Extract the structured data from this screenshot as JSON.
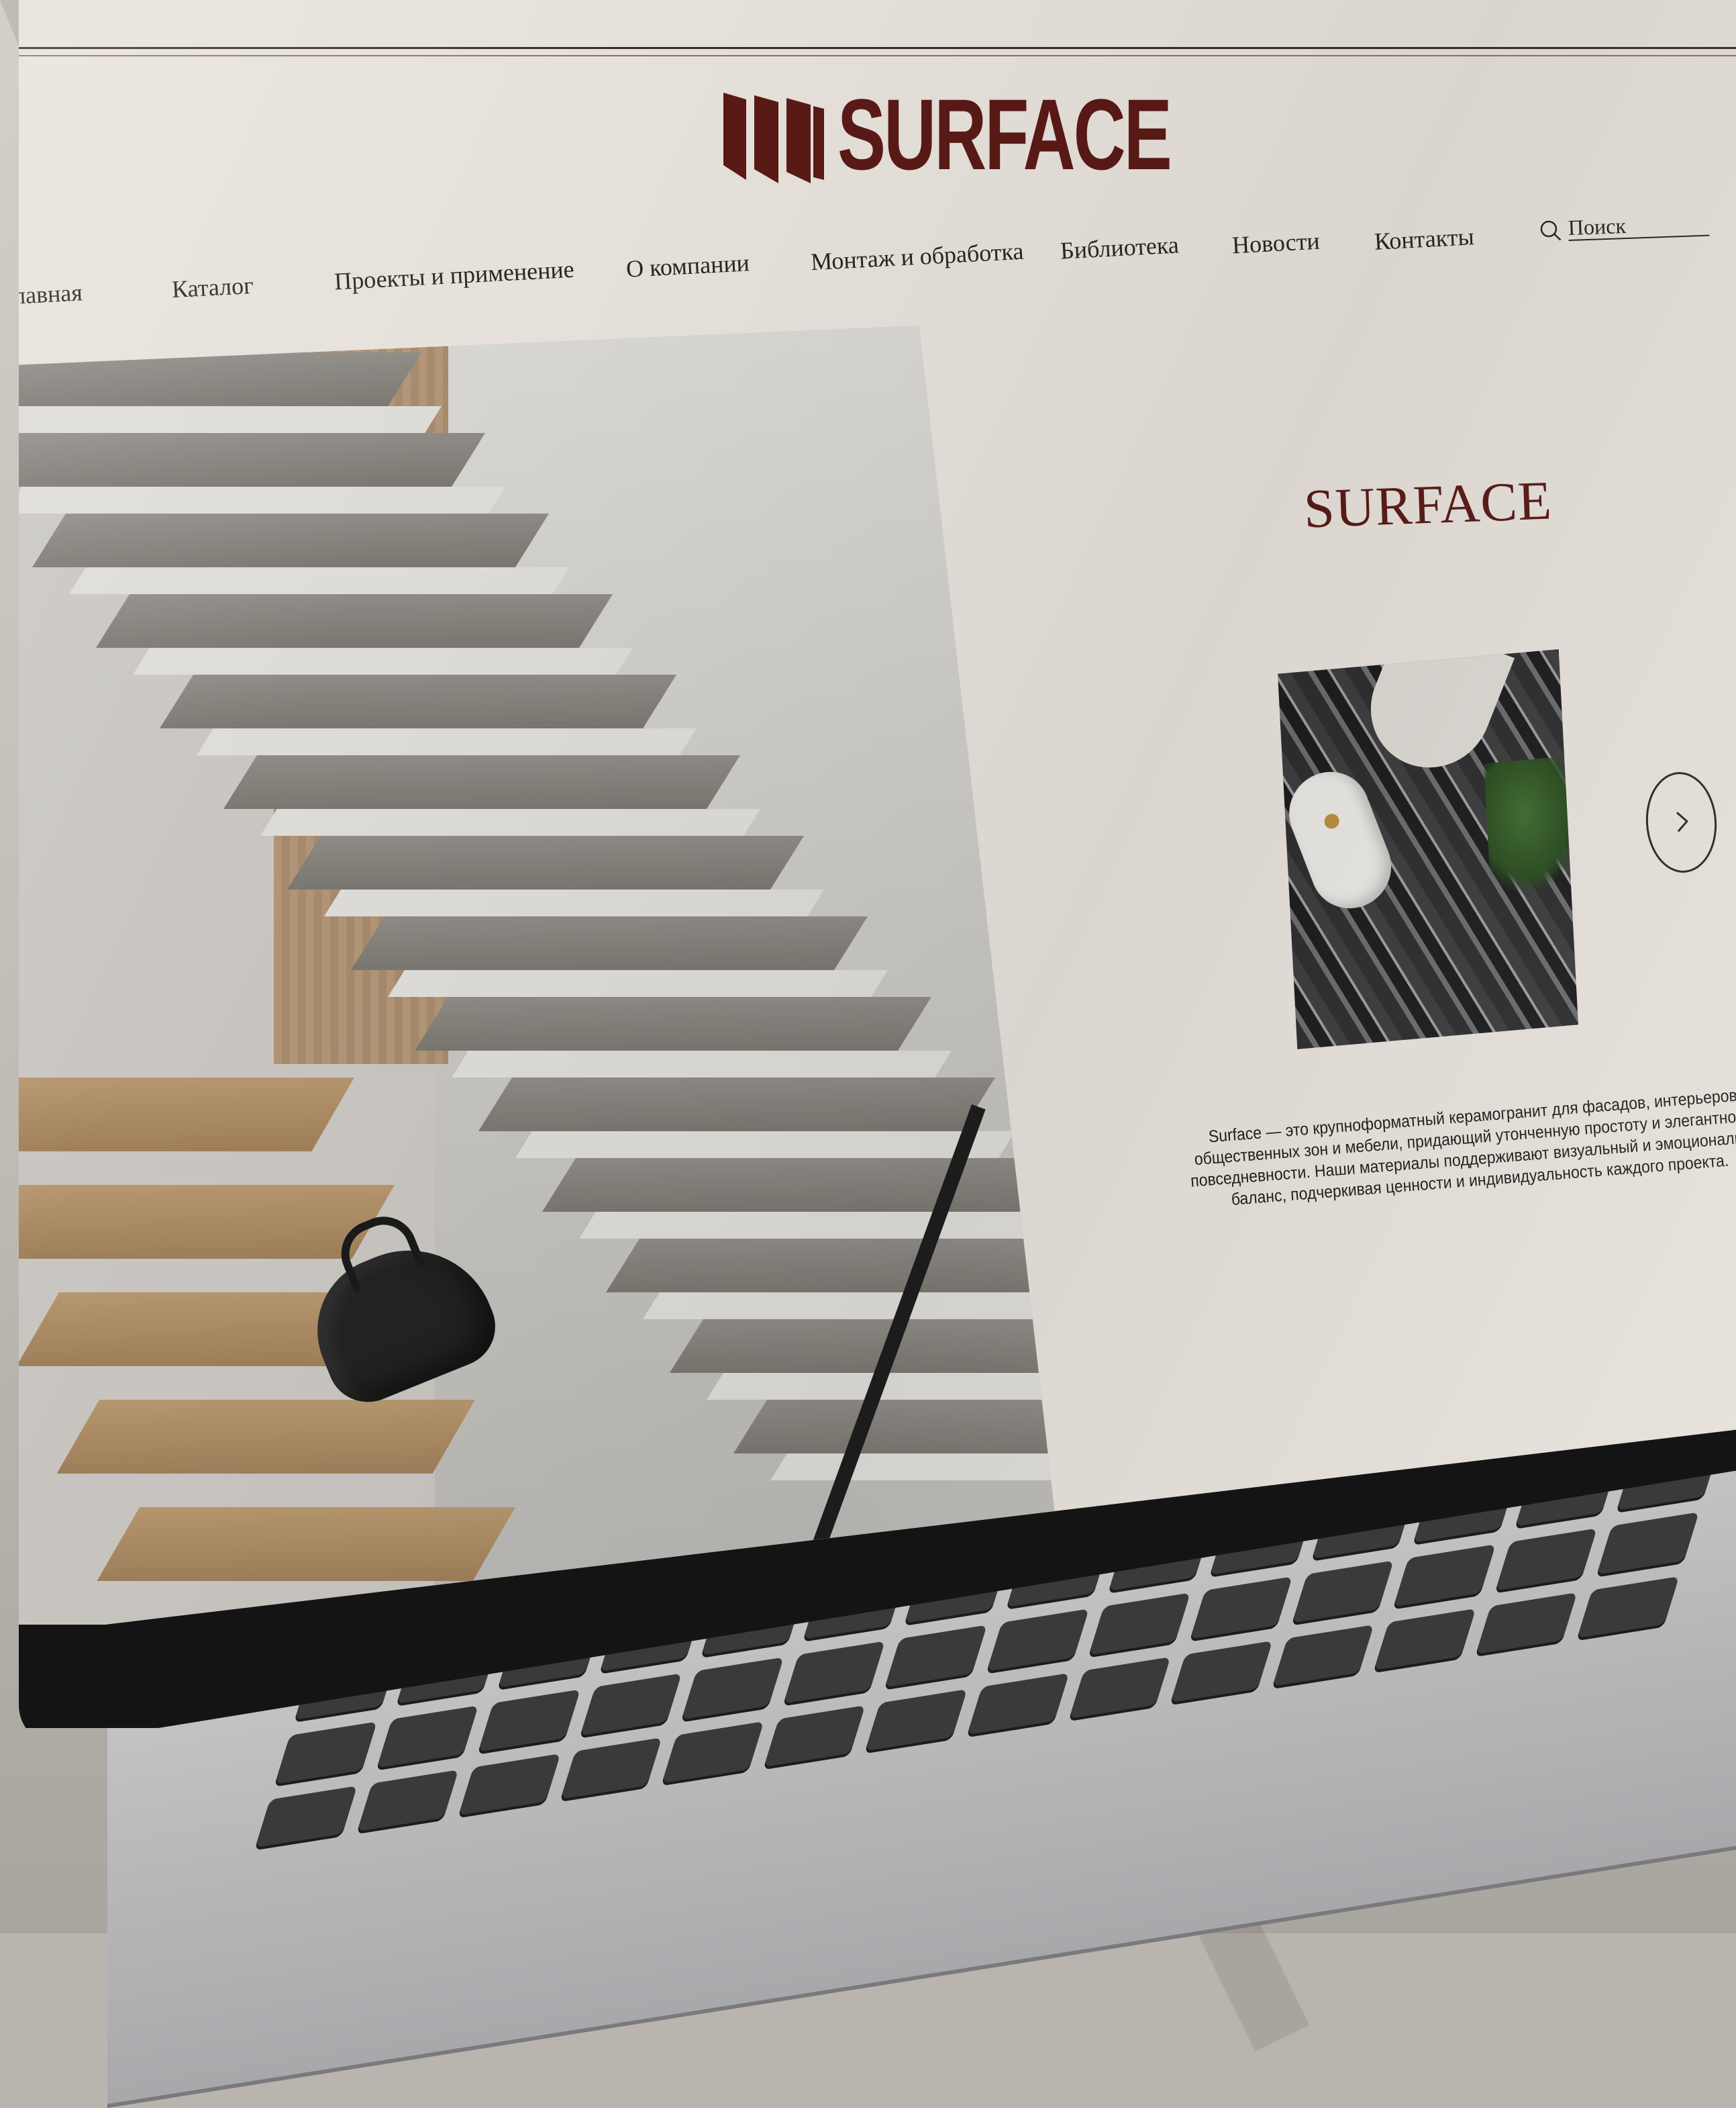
{
  "logo": {
    "text": "SURFACE",
    "color": "#5a1a16"
  },
  "nav": {
    "items": [
      {
        "label": "лавная",
        "name": "nav-item-home"
      },
      {
        "label": "Каталог",
        "name": "nav-item-catalog"
      },
      {
        "label": "Проекты и применение",
        "name": "nav-item-projects"
      },
      {
        "label": "О компании",
        "name": "nav-item-about"
      },
      {
        "label": "Монтаж и обработка",
        "name": "nav-item-installation"
      },
      {
        "label": "Библиотека",
        "name": "nav-item-library"
      },
      {
        "label": "Новости",
        "name": "nav-item-news"
      },
      {
        "label": "Контакты",
        "name": "nav-item-contacts"
      }
    ]
  },
  "search": {
    "placeholder": "Поиск",
    "icon": "search-icon"
  },
  "hero": {
    "image": "staircase-photo"
  },
  "content": {
    "title": "SURFACE",
    "description_lines": [
      "Surface — это крупноформатный керамогранит для фасадов, интерьеров,",
      "общественных зон и мебели, придающий утонченную простоту и элегантность",
      "повседневности. Наши материалы поддерживают визуальный и эмоциональный",
      "баланс, подчеркивая ценности и индивидуальность каждого проекта."
    ],
    "next_icon": "chevron-right-icon"
  },
  "colors": {
    "accent": "#5a1a16",
    "background": "#e6e1da",
    "text": "#2b2522"
  }
}
